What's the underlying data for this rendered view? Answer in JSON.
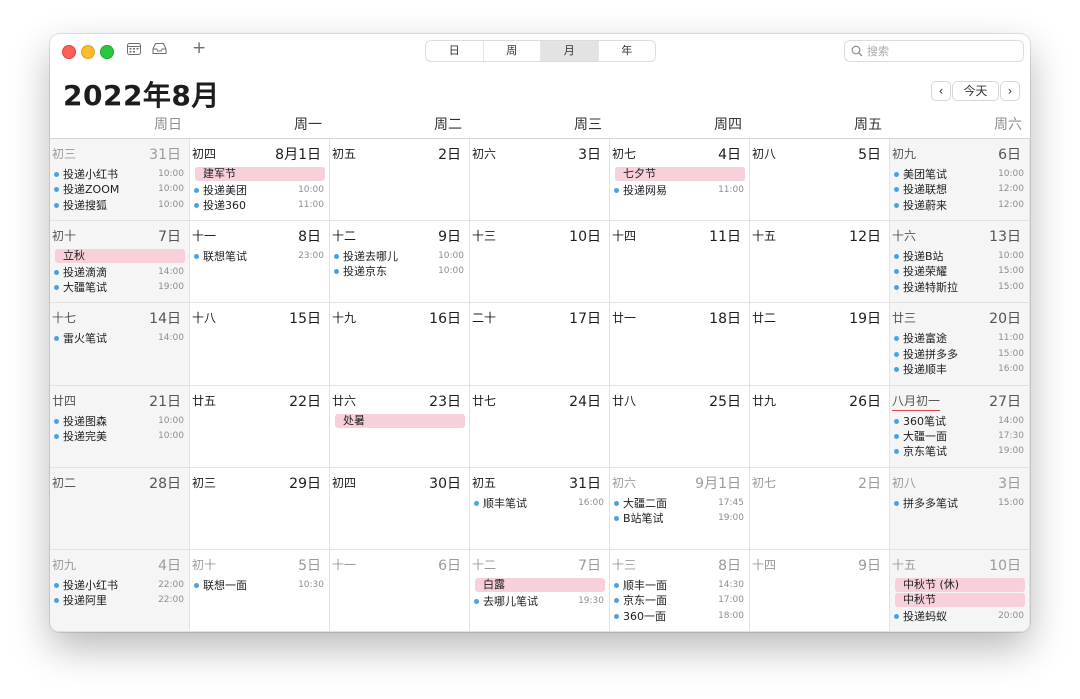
{
  "toolbar": {
    "view_tabs": [
      "日",
      "周",
      "月",
      "年"
    ],
    "active_tab": "月",
    "search_placeholder": "搜索",
    "add_label": "+"
  },
  "header": {
    "title": "2022年8月",
    "today_label": "今天",
    "prev_label": "‹",
    "next_label": "›"
  },
  "weekdays": [
    "周日",
    "周一",
    "周二",
    "周三",
    "周四",
    "周五",
    "周六"
  ],
  "colors": {
    "event_dot": "#4ba3dd",
    "holiday_banner": "#f8d0da",
    "weekend_bg": "#f5f5f5",
    "holiday_underline": "#e0434e"
  },
  "weeks": [
    [
      {
        "lunar": "初三",
        "day": "31日",
        "dim": true,
        "events": [
          {
            "name": "投递小红书",
            "time": "10:00"
          },
          {
            "name": "投递ZOOM",
            "time": "10:00"
          },
          {
            "name": "投递搜狐",
            "time": "10:00"
          }
        ]
      },
      {
        "lunar": "初四",
        "day": "8月1日",
        "banners": [
          "建军节"
        ],
        "events": [
          {
            "name": "投递美团",
            "time": "10:00"
          },
          {
            "name": "投递360",
            "time": "11:00"
          }
        ]
      },
      {
        "lunar": "初五",
        "day": "2日"
      },
      {
        "lunar": "初六",
        "day": "3日"
      },
      {
        "lunar": "初七",
        "day": "4日",
        "banners": [
          "七夕节"
        ],
        "events": [
          {
            "name": "投递网易",
            "time": "11:00"
          }
        ]
      },
      {
        "lunar": "初八",
        "day": "5日"
      },
      {
        "lunar": "初九",
        "day": "6日",
        "events": [
          {
            "name": "美团笔试",
            "time": "10:00"
          },
          {
            "name": "投递联想",
            "time": "12:00"
          },
          {
            "name": "投递蔚来",
            "time": "12:00"
          }
        ]
      }
    ],
    [
      {
        "lunar": "初十",
        "day": "7日",
        "banners": [
          "立秋"
        ],
        "events": [
          {
            "name": "投递滴滴",
            "time": "14:00"
          },
          {
            "name": "大疆笔试",
            "time": "19:00"
          }
        ]
      },
      {
        "lunar": "十一",
        "day": "8日",
        "events": [
          {
            "name": "联想笔试",
            "time": "23:00"
          }
        ]
      },
      {
        "lunar": "十二",
        "day": "9日",
        "events": [
          {
            "name": "投递去哪儿",
            "time": "10:00"
          },
          {
            "name": "投递京东",
            "time": "10:00"
          }
        ]
      },
      {
        "lunar": "十三",
        "day": "10日"
      },
      {
        "lunar": "十四",
        "day": "11日"
      },
      {
        "lunar": "十五",
        "day": "12日"
      },
      {
        "lunar": "十六",
        "day": "13日",
        "events": [
          {
            "name": "投递B站",
            "time": "10:00"
          },
          {
            "name": "投递荣耀",
            "time": "15:00"
          },
          {
            "name": "投递特斯拉",
            "time": "15:00"
          }
        ]
      }
    ],
    [
      {
        "lunar": "十七",
        "day": "14日",
        "events": [
          {
            "name": "雷火笔试",
            "time": "14:00"
          }
        ]
      },
      {
        "lunar": "十八",
        "day": "15日"
      },
      {
        "lunar": "十九",
        "day": "16日"
      },
      {
        "lunar": "二十",
        "day": "17日"
      },
      {
        "lunar": "廿一",
        "day": "18日"
      },
      {
        "lunar": "廿二",
        "day": "19日"
      },
      {
        "lunar": "廿三",
        "day": "20日",
        "events": [
          {
            "name": "投递富途",
            "time": "11:00"
          },
          {
            "name": "投递拼多多",
            "time": "15:00"
          },
          {
            "name": "投递顺丰",
            "time": "16:00"
          }
        ]
      }
    ],
    [
      {
        "lunar": "廿四",
        "day": "21日",
        "events": [
          {
            "name": "投递图森",
            "time": "10:00"
          },
          {
            "name": "投递完美",
            "time": "10:00"
          }
        ]
      },
      {
        "lunar": "廿五",
        "day": "22日"
      },
      {
        "lunar": "廿六",
        "day": "23日",
        "banners": [
          "处暑"
        ]
      },
      {
        "lunar": "廿七",
        "day": "24日"
      },
      {
        "lunar": "廿八",
        "day": "25日"
      },
      {
        "lunar": "廿九",
        "day": "26日"
      },
      {
        "lunar": "八月初一",
        "day": "27日",
        "holiday": true,
        "events": [
          {
            "name": "360笔试",
            "time": "14:00"
          },
          {
            "name": "大疆一面",
            "time": "17:30"
          },
          {
            "name": "京东笔试",
            "time": "19:00"
          }
        ]
      }
    ],
    [
      {
        "lunar": "初二",
        "day": "28日"
      },
      {
        "lunar": "初三",
        "day": "29日"
      },
      {
        "lunar": "初四",
        "day": "30日"
      },
      {
        "lunar": "初五",
        "day": "31日",
        "events": [
          {
            "name": "顺丰笔试",
            "time": "16:00"
          }
        ]
      },
      {
        "lunar": "初六",
        "day": "9月1日",
        "dim": true,
        "events": [
          {
            "name": "大疆二面",
            "time": "17:45"
          },
          {
            "name": "B站笔试",
            "time": "19:00"
          }
        ]
      },
      {
        "lunar": "初七",
        "day": "2日",
        "dim": true
      },
      {
        "lunar": "初八",
        "day": "3日",
        "dim": true,
        "events": [
          {
            "name": "拼多多笔试",
            "time": "15:00"
          }
        ]
      }
    ],
    [
      {
        "lunar": "初九",
        "day": "4日",
        "dim": true,
        "events": [
          {
            "name": "投递小红书",
            "time": "22:00"
          },
          {
            "name": "投递阿里",
            "time": "22:00"
          }
        ]
      },
      {
        "lunar": "初十",
        "day": "5日",
        "dim": true,
        "events": [
          {
            "name": "联想一面",
            "time": "10:30"
          }
        ]
      },
      {
        "lunar": "十一",
        "day": "6日",
        "dim": true
      },
      {
        "lunar": "十二",
        "day": "7日",
        "dim": true,
        "banners": [
          "白露"
        ],
        "events": [
          {
            "name": "去哪儿笔试",
            "time": "19:30"
          }
        ]
      },
      {
        "lunar": "十三",
        "day": "8日",
        "dim": true,
        "events": [
          {
            "name": "顺丰一面",
            "time": "14:30"
          },
          {
            "name": "京东一面",
            "time": "17:00"
          },
          {
            "name": "360一面",
            "time": "18:00"
          }
        ]
      },
      {
        "lunar": "十四",
        "day": "9日",
        "dim": true
      },
      {
        "lunar": "十五",
        "day": "10日",
        "dim": true,
        "banners": [
          "中秋节 (休)",
          "中秋节"
        ],
        "events": [
          {
            "name": "投递蚂蚁",
            "time": "20:00"
          }
        ]
      }
    ]
  ]
}
